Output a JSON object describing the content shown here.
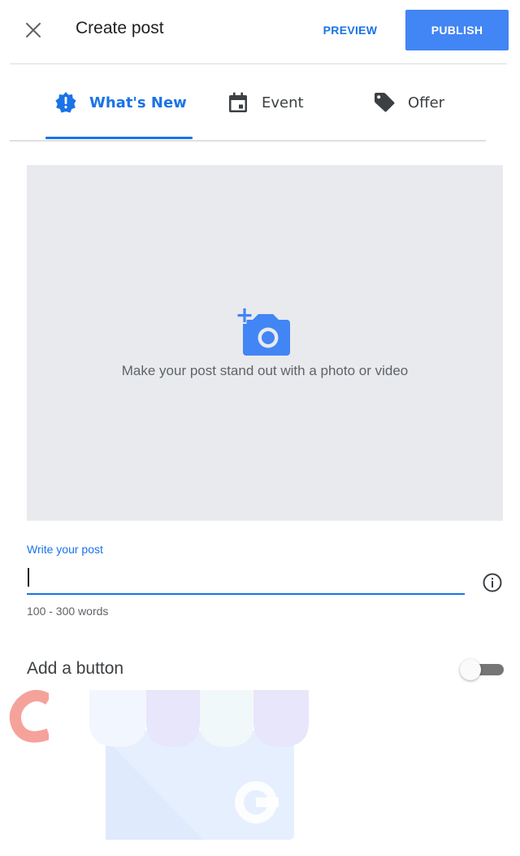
{
  "header": {
    "close_icon": "close-icon",
    "title": "Create post",
    "preview_label": "PREVIEW",
    "publish_label": "PUBLISH"
  },
  "tabs": [
    {
      "label": "What's New",
      "icon": "alert-badge-icon",
      "active": true
    },
    {
      "label": "Event",
      "icon": "calendar-icon",
      "active": false
    },
    {
      "label": "Offer",
      "icon": "tag-icon",
      "active": false
    }
  ],
  "media": {
    "icon": "add-photo-icon",
    "text": "Make your post stand out with a photo or video"
  },
  "post": {
    "label": "Write your post",
    "value": "",
    "hint": "100 - 300 words",
    "info_icon": "info-icon"
  },
  "add_button": {
    "label": "Add a button",
    "enabled": false
  },
  "colors": {
    "accent": "#1a73e8",
    "publish_bg": "#4285f4",
    "media_bg": "#e8eaed"
  }
}
